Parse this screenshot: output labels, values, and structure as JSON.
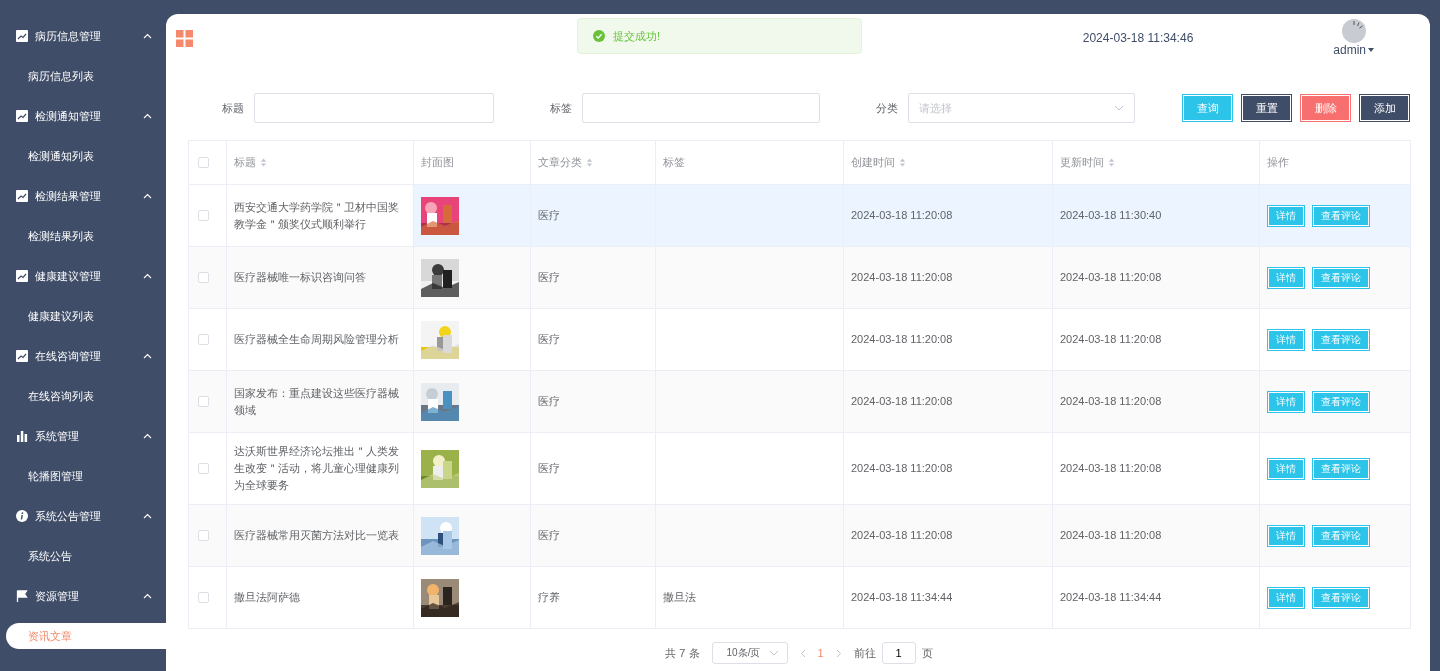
{
  "sidebar": {
    "groups": [
      {
        "kind": "chart",
        "title": "病历信息管理",
        "expanded": true,
        "items": [
          {
            "label": "病历信息列表",
            "selected": false
          }
        ]
      },
      {
        "kind": "chart",
        "title": "检测通知管理",
        "expanded": true,
        "items": [
          {
            "label": "检测通知列表",
            "selected": false
          }
        ]
      },
      {
        "kind": "chart",
        "title": "检测结果管理",
        "expanded": true,
        "items": [
          {
            "label": "检测结果列表",
            "selected": false
          }
        ]
      },
      {
        "kind": "chart",
        "title": "健康建议管理",
        "expanded": true,
        "items": [
          {
            "label": "健康建议列表",
            "selected": false
          }
        ]
      },
      {
        "kind": "chart",
        "title": "在线咨询管理",
        "expanded": true,
        "items": [
          {
            "label": "在线咨询列表",
            "selected": false
          }
        ]
      },
      {
        "kind": "bars",
        "title": "系统管理",
        "expanded": true,
        "items": [
          {
            "label": "轮播图管理",
            "selected": false
          }
        ]
      },
      {
        "kind": "info",
        "title": "系统公告管理",
        "expanded": true,
        "items": [
          {
            "label": "系统公告",
            "selected": false
          }
        ]
      },
      {
        "kind": "flag",
        "title": "资源管理",
        "expanded": true,
        "items": [
          {
            "label": "资讯文章",
            "selected": true
          }
        ]
      }
    ]
  },
  "header": {
    "datetime": "2024-03-18 11:34:46",
    "user": "admin"
  },
  "toast": {
    "message": "提交成功!"
  },
  "filters": [
    {
      "kind": "input",
      "label": "标题"
    },
    {
      "kind": "input",
      "label": "标签"
    },
    {
      "kind": "select",
      "label": "分类",
      "placeholder": "请选择"
    }
  ],
  "buttons": [
    {
      "kind": "primary",
      "label": "查询"
    },
    {
      "kind": "dark",
      "label": "重置"
    },
    {
      "kind": "danger",
      "label": "删除"
    },
    {
      "kind": "dark",
      "label": "添加"
    }
  ],
  "table": {
    "all_checked": false,
    "columns": [
      {
        "label": "标题",
        "sortable": true
      },
      {
        "label": "封面图",
        "sortable": false
      },
      {
        "label": "文章分类",
        "sortable": true
      },
      {
        "label": "标签",
        "sortable": false
      },
      {
        "label": "创建时间",
        "sortable": true
      },
      {
        "label": "更新时间",
        "sortable": true
      },
      {
        "label": "操作",
        "sortable": false
      }
    ],
    "rows": [
      {
        "checked": false,
        "highlighted": true,
        "title": "西安交通大学药学院＂卫材中国奖教学金＂颁奖仪式顺利举行",
        "cover": {
          "kind": "picture"
        },
        "category": "医疗",
        "tag": "",
        "created": "2024-03-18 11:20:08",
        "updated": "2024-03-18 11:30:40",
        "actions": [
          "详情",
          "查看评论"
        ]
      },
      {
        "checked": false,
        "highlighted": false,
        "title": "医疗器械唯一标识咨询问答",
        "cover": {
          "kind": "picture"
        },
        "category": "医疗",
        "tag": "",
        "created": "2024-03-18 11:20:08",
        "updated": "2024-03-18 11:20:08",
        "actions": [
          "详情",
          "查看评论"
        ]
      },
      {
        "checked": false,
        "highlighted": false,
        "title": "医疗器械全生命周期风险管理分析",
        "cover": {
          "kind": "picture"
        },
        "category": "医疗",
        "tag": "",
        "created": "2024-03-18 11:20:08",
        "updated": "2024-03-18 11:20:08",
        "actions": [
          "详情",
          "查看评论"
        ]
      },
      {
        "checked": false,
        "highlighted": false,
        "title": "国家发布：重点建设这些医疗器械领域",
        "cover": {
          "kind": "picture"
        },
        "category": "医疗",
        "tag": "",
        "created": "2024-03-18 11:20:08",
        "updated": "2024-03-18 11:20:08",
        "actions": [
          "详情",
          "查看评论"
        ]
      },
      {
        "checked": false,
        "highlighted": false,
        "title": "达沃斯世界经济论坛推出＂人类发生改变＂活动，将儿童心理健康列为全球要务",
        "cover": {
          "kind": "picture"
        },
        "category": "医疗",
        "tag": "",
        "created": "2024-03-18 11:20:08",
        "updated": "2024-03-18 11:20:08",
        "actions": [
          "详情",
          "查看评论"
        ]
      },
      {
        "checked": false,
        "highlighted": false,
        "title": "医疗器械常用灭菌方法对比一览表",
        "cover": {
          "kind": "picture"
        },
        "category": "医疗",
        "tag": "",
        "created": "2024-03-18 11:20:08",
        "updated": "2024-03-18 11:20:08",
        "actions": [
          "详情",
          "查看评论"
        ]
      },
      {
        "checked": false,
        "highlighted": false,
        "title": "撒旦法阿萨德",
        "cover": {
          "kind": "picture"
        },
        "category": "疗养",
        "tag": "撒旦法",
        "created": "2024-03-18 11:34:44",
        "updated": "2024-03-18 11:34:44",
        "actions": [
          "详情",
          "查看评论"
        ]
      }
    ]
  },
  "pagination": {
    "total": "共 7 条",
    "page_size": "10条/页",
    "pages": [
      {
        "label": "1",
        "selected": true
      }
    ],
    "goto_label": "前往",
    "goto_value": "1",
    "goto_suffix": "页"
  }
}
